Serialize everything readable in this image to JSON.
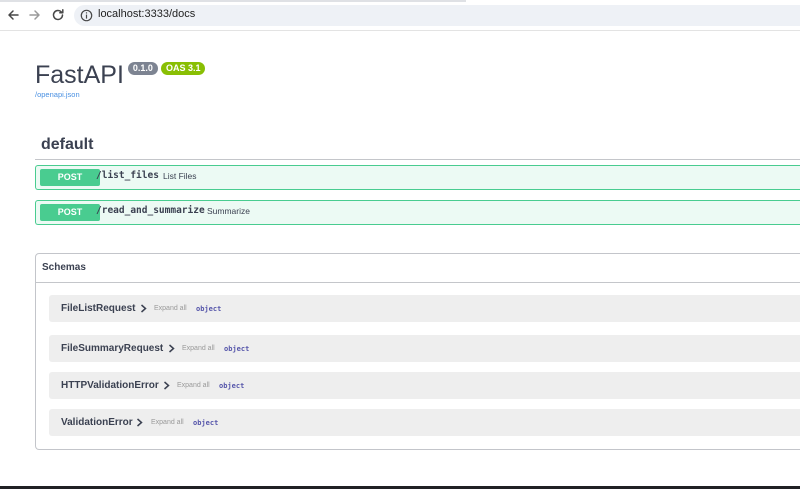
{
  "browser": {
    "url": "localhost:3333/docs",
    "icons": [
      "back-arrow-icon",
      "forward-arrow-icon",
      "reload-icon",
      "info-icon"
    ]
  },
  "header": {
    "title": "FastAPI",
    "version_badge": "0.1.0",
    "oas_badge": "OAS 3.1",
    "openapi_link": "/openapi.json",
    "colors": {
      "version_badge": "#7d8492",
      "oas_badge": "#89bf04",
      "link": "#4990e2"
    }
  },
  "tags": [
    {
      "name": "default",
      "operations": [
        {
          "method": "POST",
          "path": "/list_files",
          "summary": "List Files"
        },
        {
          "method": "POST",
          "path": "/read_and_summarize",
          "summary": "Summarize"
        }
      ]
    }
  ],
  "post_color": "#49cc90",
  "schemas": {
    "title": "Schemas",
    "models": [
      {
        "name": "FileListRequest",
        "expand_label": "Expand all",
        "type": "object"
      },
      {
        "name": "FileSummaryRequest",
        "expand_label": "Expand all",
        "type": "object"
      },
      {
        "name": "HTTPValidationError",
        "expand_label": "Expand all",
        "type": "object"
      },
      {
        "name": "ValidationError",
        "expand_label": "Expand all",
        "type": "object"
      }
    ]
  }
}
